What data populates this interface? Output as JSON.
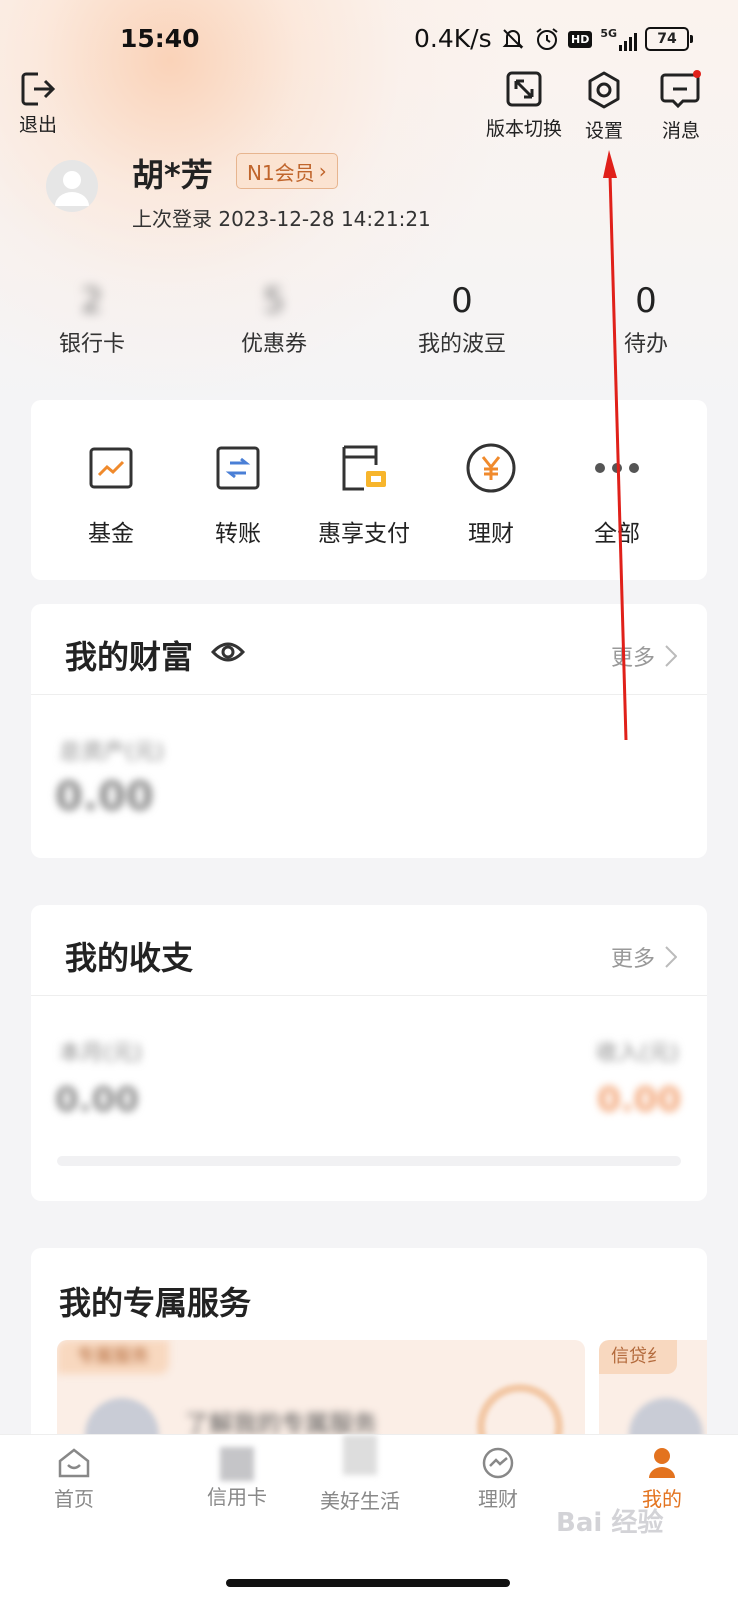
{
  "status_bar": {
    "time": "15:40",
    "network_speed": "0.4K/s",
    "battery": "74",
    "signal_label": "5G",
    "hd_label": "HD"
  },
  "top_actions": {
    "logout": "退出",
    "version_switch": "版本切换",
    "settings": "设置",
    "messages": "消息"
  },
  "profile": {
    "name": "胡*芳",
    "member_badge": "N1会员",
    "last_login": "上次登录 2023-12-28 14:21:21"
  },
  "stats": [
    {
      "value": "2",
      "label": "银行卡"
    },
    {
      "value": "5",
      "label": "优惠券"
    },
    {
      "value": "0",
      "label": "我的波豆"
    },
    {
      "value": "0",
      "label": "待办"
    }
  ],
  "shortcuts": [
    {
      "label": "基金",
      "icon": "fund-chart-icon"
    },
    {
      "label": "转账",
      "icon": "transfer-arrows-icon"
    },
    {
      "label": "惠享支付",
      "icon": "card-pay-icon"
    },
    {
      "label": "理财",
      "icon": "yen-coin-icon"
    },
    {
      "label": "全部",
      "icon": "more-dots-icon"
    }
  ],
  "wealth": {
    "title": "我的财富",
    "more": "更多",
    "blurred_label": "总资产(元)",
    "blurred_value": "0.00"
  },
  "income": {
    "title": "我的收支",
    "more": "更多",
    "left_label": "本月(元)",
    "left_value": "0.00",
    "right_label": "收入(元)",
    "right_value": "0.00"
  },
  "services": {
    "title": "我的专属服务",
    "tag1": "专属服务",
    "tag2": "信贷纟",
    "blurred_text": "了解我的专属服务"
  },
  "tabbar": [
    {
      "label": "首页",
      "active": false
    },
    {
      "label": "信用卡",
      "active": false
    },
    {
      "label": "美好生活",
      "active": false
    },
    {
      "label": "理财",
      "active": false
    },
    {
      "label": "我的",
      "active": true
    }
  ],
  "colors": {
    "accent": "#e3731f",
    "arrow": "#e0201a",
    "badge_bg": "#fbe3d1"
  },
  "watermark": "Bai 经验"
}
